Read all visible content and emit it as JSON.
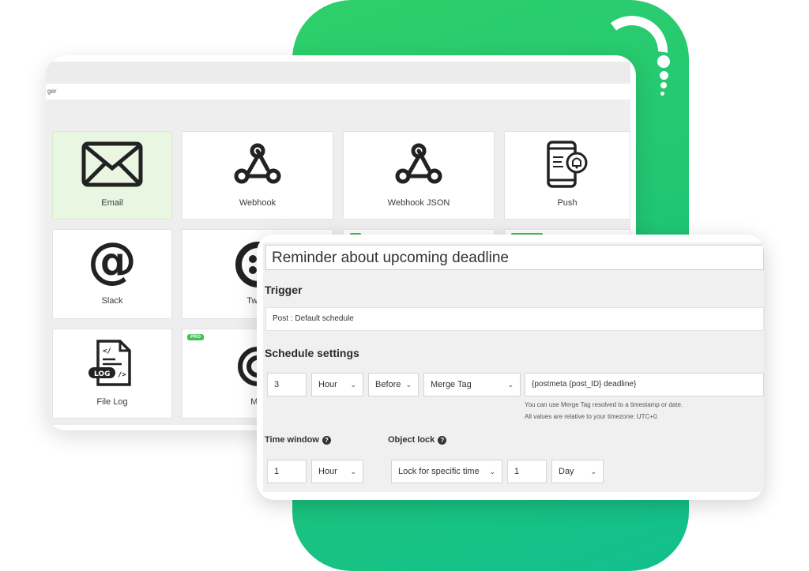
{
  "colors": {
    "brand_green": "#22c672",
    "pro_badge": "#3fc153",
    "selected_tile": "#e9f6e2"
  },
  "picker": {
    "breadcrumb": "ger",
    "tiles": [
      {
        "label": "Email",
        "icon": "envelope-icon",
        "selected": true
      },
      {
        "label": "Webhook",
        "icon": "webhook-icon"
      },
      {
        "label": "Webhook JSON",
        "icon": "webhook-icon"
      },
      {
        "label": "Push",
        "icon": "mobile-push-icon"
      },
      {
        "label": "Slack",
        "icon": "at-sign-icon"
      },
      {
        "label": "Twilio",
        "icon": "twilio-icon"
      },
      {
        "label": "File Log",
        "icon": "file-log-icon"
      },
      {
        "label": "Mai",
        "icon": "mailgun-icon",
        "badge": "PRO"
      }
    ],
    "email_overlay_text": "Email",
    "log_badge": "LOG"
  },
  "form": {
    "title": "Reminder about upcoming deadline",
    "trigger_heading": "Trigger",
    "trigger_value": "Post : Default schedule",
    "schedule_heading": "Schedule settings",
    "amount": "3",
    "unit": "Hour",
    "relation": "Before",
    "source": "Merge Tag",
    "merge_tag": "{postmeta {post_ID} deadline}",
    "note1": "You can use Merge Tag resolved to a timestamp or date.",
    "note2": "All values are relative to your timezone: UTC+0.",
    "time_window_label": "Time window",
    "time_window_amount": "1",
    "time_window_unit": "Hour",
    "object_lock_label": "Object lock",
    "lock_mode": "Lock for specific time",
    "lock_amount": "1",
    "lock_unit": "Day"
  }
}
